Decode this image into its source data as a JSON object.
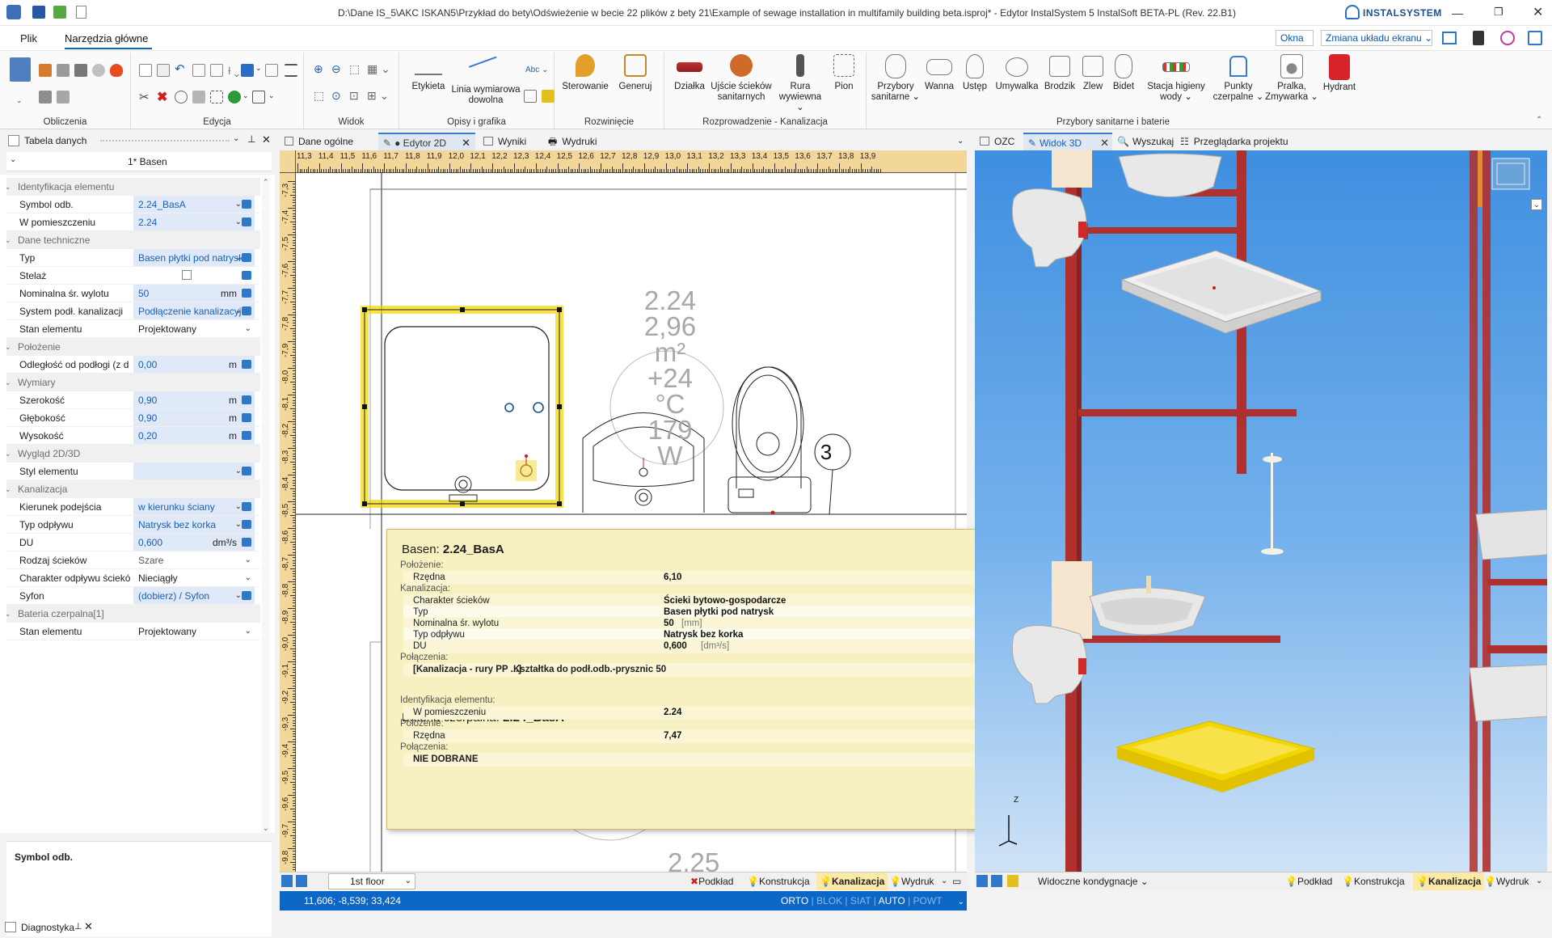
{
  "title": "D:\\Dane IS_5\\AKC ISKAN5\\Przykład do bety\\Odświeżenie w becie 22 plików z bety 21\\Example of sewage installation in multifamily building beta.isproj* - Edytor InstalSystem 5 InstalSoft BETA-PL (Rev. 22.B1)",
  "brand": "INSTALSYSTEM",
  "menu": {
    "file": "Plik",
    "main": "Narzędzia główne",
    "windows": "Okna",
    "layout": "Zmiana układu ekranu"
  },
  "ribbon": {
    "groups": [
      "Obliczenia",
      "Edycja",
      "Widok",
      "Opisy i grafika",
      "Rozwinięcie",
      "Rozprowadzenie - Kanalizacja",
      "Przybory sanitarne i baterie"
    ],
    "buttons": {
      "etykieta": "Etykieta",
      "linia1": "Linia wymiarowa",
      "linia2": "dowolna",
      "abc": "Abc",
      "sterowanie": "Sterowanie",
      "generuj": "Generuj",
      "dzialka": "Działka",
      "ujscie1": "Ujście ścieków",
      "ujscie2": "sanitarnych",
      "rura1": "Rura",
      "rura2": "wywiewna",
      "pion": "Pion",
      "przybory1": "Przybory",
      "przybory2": "sanitarne",
      "wanna": "Wanna",
      "ustep": "Ustęp",
      "umywalka": "Umywalka",
      "brodzik": "Brodzik",
      "zlew": "Zlew",
      "bidet": "Bidet",
      "stacja1": "Stacja higieny",
      "stacja2": "wody",
      "punkty1": "Punkty",
      "punkty2": "czerpalne",
      "pralka1": "Pralka,",
      "pralka2": "Zmywarka",
      "hydrant": "Hydrant"
    }
  },
  "left_panel": {
    "tab": "Tabela danych",
    "object": "1* Basen",
    "rows": [
      {
        "type": "cat",
        "label": "Identyfikacja elementu"
      },
      {
        "type": "prop",
        "label": "Symbol odb.",
        "value": "2.24_BasA",
        "style": "blue",
        "dd": true,
        "icon": true
      },
      {
        "type": "prop",
        "label": "W pomieszczeniu",
        "value": "2.24",
        "style": "blue",
        "dd": true,
        "icon": true
      },
      {
        "type": "cat",
        "label": "Dane techniczne"
      },
      {
        "type": "prop",
        "label": "Typ",
        "value": "Basen płytki pod natrysk",
        "style": "blue",
        "dd": true,
        "icon": true
      },
      {
        "type": "prop",
        "label": "Stelaż",
        "value": "",
        "style": "plain",
        "checkbox": true,
        "icon": true
      },
      {
        "type": "prop",
        "label": "Nominalna śr. wylotu",
        "value": "50",
        "unit": "mm",
        "style": "blue",
        "icon": true
      },
      {
        "type": "prop",
        "label": "System podł. kanalizacji",
        "value": "Podłączenie kanalizacyj",
        "style": "blue",
        "dd": true,
        "icon": true
      },
      {
        "type": "prop",
        "label": "Stan elementu",
        "value": "Projektowany",
        "style": "plain",
        "dd": true
      },
      {
        "type": "cat",
        "label": "Położenie"
      },
      {
        "type": "prop",
        "label": "Odległość od podłogi (z d",
        "value": "0,00",
        "unit": "m",
        "style": "blue",
        "icon": true
      },
      {
        "type": "cat",
        "label": "Wymiary"
      },
      {
        "type": "prop",
        "label": "Szerokość",
        "value": "0,90",
        "unit": "m",
        "style": "blue",
        "icon": true
      },
      {
        "type": "prop",
        "label": "Głębokość",
        "value": "0,90",
        "unit": "m",
        "style": "blue",
        "icon": true
      },
      {
        "type": "prop",
        "label": "Wysokość",
        "value": "0,20",
        "unit": "m",
        "style": "blue",
        "icon": true
      },
      {
        "type": "cat",
        "label": "Wygląd 2D/3D"
      },
      {
        "type": "prop",
        "label": "Styl elementu",
        "value": "",
        "style": "blue",
        "dd": true,
        "icon": true
      },
      {
        "type": "cat",
        "label": "Kanalizacja"
      },
      {
        "type": "prop",
        "label": "Kierunek podejścia",
        "value": "w kierunku ściany",
        "style": "blue",
        "dd": true,
        "icon": true
      },
      {
        "type": "prop",
        "label": "Typ odpływu",
        "value": "Natrysk bez korka",
        "style": "blue",
        "dd": true,
        "icon": true
      },
      {
        "type": "prop",
        "label": "DU",
        "value": "0,600",
        "unit": "dm³/s",
        "style": "blue",
        "icon": true
      },
      {
        "type": "prop",
        "label": "Rodzaj ścieków",
        "value": "Szare",
        "style": "plain",
        "dd": true,
        "grey": true
      },
      {
        "type": "prop",
        "label": "Charakter odpływu ściekó",
        "value": "Nieciągły",
        "style": "plain",
        "dd": true
      },
      {
        "type": "prop",
        "label": "Syfon",
        "value": "(dobierz) / Syfon",
        "style": "blue",
        "dd": true,
        "icon": true
      },
      {
        "type": "cat",
        "label": "Bateria czerpalna[1]"
      },
      {
        "type": "prop",
        "label": "Stan elementu",
        "value": "Projektowany",
        "style": "plain",
        "dd": true
      }
    ],
    "help_title": "Symbol odb."
  },
  "bottom_panel": {
    "tab": "Diagnostyka"
  },
  "editor": {
    "tabs": [
      "Dane ogólne",
      "● Edytor 2D",
      "Wyniki",
      "Wydruki"
    ],
    "ruler_h": [
      "11,3",
      "11,4",
      "11,5",
      "11,6",
      "11,7",
      "11,8",
      "11,9",
      "12,0",
      "12,1",
      "12,2",
      "12,3",
      "12,4",
      "12,5",
      "12,6",
      "12,7",
      "12,8",
      "12,9",
      "13,0",
      "13,1",
      "13,2",
      "13,3",
      "13,4",
      "13,5",
      "13,6",
      "13,7",
      "13,8",
      "13,9"
    ],
    "ruler_v": [
      "-7,3",
      "-7,4",
      "-7,5",
      "-7,6",
      "-7,7",
      "-7,8",
      "-7,9",
      "-8,0",
      "-8,1",
      "-8,2",
      "-8,3",
      "-8,4",
      "-8,5",
      "-8,6",
      "-8,7",
      "-8,8",
      "-8,9",
      "-9,0",
      "-9,1",
      "-9,2",
      "-9,3",
      "-9,4",
      "-9,5",
      "-9,6",
      "-9,7",
      "-9,8"
    ],
    "room_label": {
      "name": "2.24",
      "area": "2,96 m²",
      "temp": "+24 °C",
      "power": "179 W"
    },
    "room2_label": "2.25",
    "node_number": "3",
    "floor": "1st floor",
    "layers": [
      "Podkład",
      "Konstrukcja",
      "Kanalizacja",
      "Wydruk"
    ],
    "coords": "11,606; -8,539; 33,424",
    "modes": [
      "ORTO",
      "BLOK",
      "SIAT",
      "AUTO",
      "POWT"
    ]
  },
  "tooltip": {
    "title_prefix": "Basen:",
    "title_value": "2.24_BasA",
    "rows": [
      {
        "type": "sec",
        "label": "Położenie:"
      },
      {
        "type": "kv",
        "key": "Rzędna",
        "value": "6,10"
      },
      {
        "type": "sec",
        "label": "Kanalizacja:"
      },
      {
        "type": "kv",
        "key": "Charakter ścieków",
        "value": "Ścieki bytowo-gospodarcze"
      },
      {
        "type": "kv",
        "key": "Typ",
        "value": "Basen płytki pod natrysk"
      },
      {
        "type": "kv",
        "key": "Nominalna śr. wylotu",
        "value": "50",
        "unit": "[mm]"
      },
      {
        "type": "kv",
        "key": "Typ odpływu",
        "value": "Natrysk bez korka"
      },
      {
        "type": "kv",
        "key": "DU",
        "value": "0,600",
        "unit": "[dm³/s]"
      },
      {
        "type": "sec",
        "label": "Połączenia:"
      },
      {
        "type": "conn",
        "key": "[Kanalizacja - rury PP ...]",
        "value": "Kształtka do podł.odb.-prysznic 50"
      }
    ],
    "title2_prefix": "Bateria czerpalna:",
    "title2_value": "2.24_BasA",
    "rows2": [
      {
        "type": "sec",
        "label": "Identyfikacja elementu:"
      },
      {
        "type": "kv",
        "key": "W pomieszczeniu",
        "value": "2.24"
      },
      {
        "type": "sec",
        "label": "Położenie:"
      },
      {
        "type": "kv",
        "key": "Rzędna",
        "value": "7,47"
      },
      {
        "type": "sec",
        "label": "Połączenia:"
      },
      {
        "type": "kv",
        "key": "NIE DOBRANE",
        "value": ""
      }
    ]
  },
  "view3d": {
    "tabs": [
      "OZC",
      "Widok 3D",
      "Wyszukaj",
      "Przeglądarka projektu"
    ],
    "visible": "Widoczne kondygnacje",
    "layers": [
      "Podkład",
      "Konstrukcja",
      "Kanalizacja",
      "Wydruk"
    ],
    "axis_z": "Z"
  },
  "colors": {
    "accent": "#0a64c2",
    "status_blue": "#0b66c6",
    "selection": "#f2d600",
    "pipe": "#b0302d",
    "sky_top": "#3f8fe0",
    "sky_bottom": "#cfe3f6"
  }
}
